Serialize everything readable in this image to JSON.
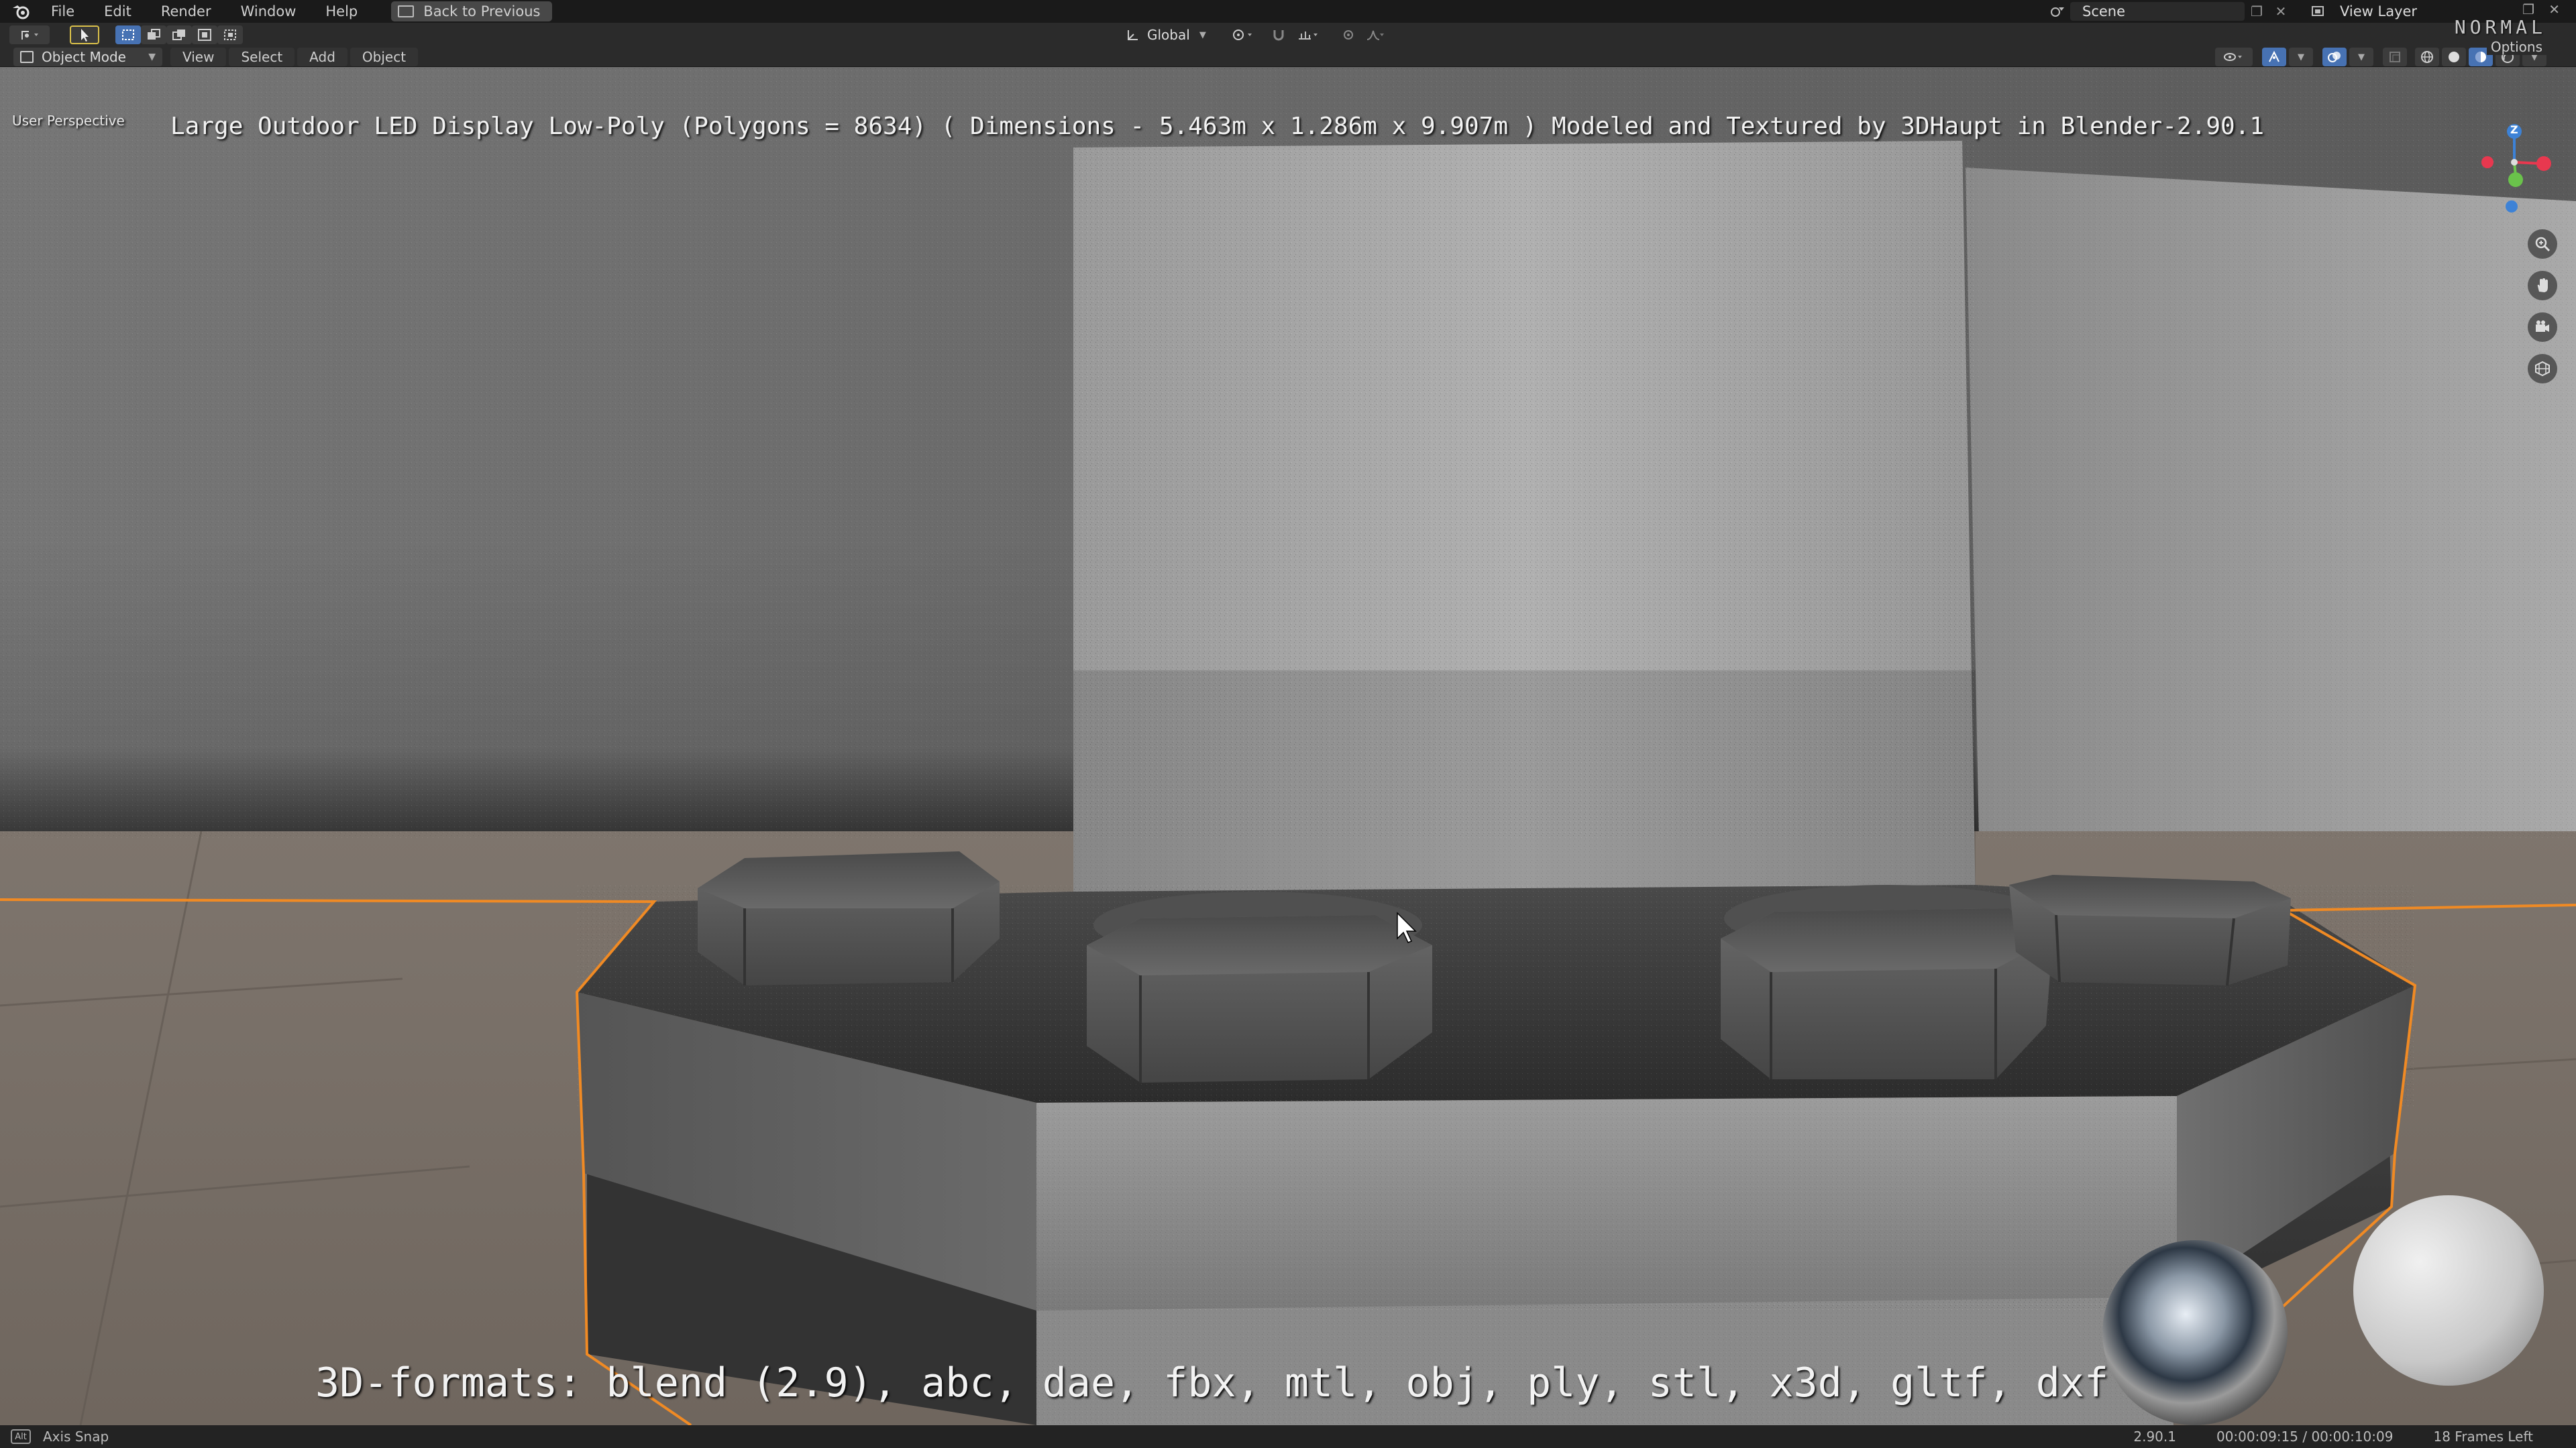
{
  "topbar": {
    "menus": [
      "File",
      "Edit",
      "Render",
      "Window",
      "Help"
    ],
    "back_button": "Back to Previous",
    "scene_label": "Scene",
    "view_layer_label": "View Layer",
    "overlay_mode": "NORMAL",
    "options_label": "Options"
  },
  "header": {
    "mode": "Object Mode",
    "menus": [
      "View",
      "Select",
      "Add",
      "Object"
    ],
    "transform_orientation": "Global"
  },
  "viewport": {
    "perspective_label": "User Perspective",
    "title": "Large Outdoor LED Display Low-Poly (Polygons = 8634) ( Dimensions -  5.463m x 1.286m x 9.907m ) Modeled and Textured by 3DHaupt in Blender-2.90.1",
    "formats": "3D-formats: blend (2.9), abc, dae, fbx, mtl, obj, ply, stl, x3d, gltf, dxf",
    "gizmo_axis_label": "Z",
    "colors": {
      "selection_outline": "#f08a24",
      "axis_x": "#e8384f",
      "axis_y": "#6ac24b",
      "axis_z": "#3d82d6",
      "active_button": "#4772b3"
    }
  },
  "statusbar": {
    "key_hint": "Alt",
    "action": "Axis Snap",
    "version": "2.90.1",
    "timecode": "00:00:09:15 / 00:00:10:09",
    "frames_left": "18 Frames Left"
  }
}
